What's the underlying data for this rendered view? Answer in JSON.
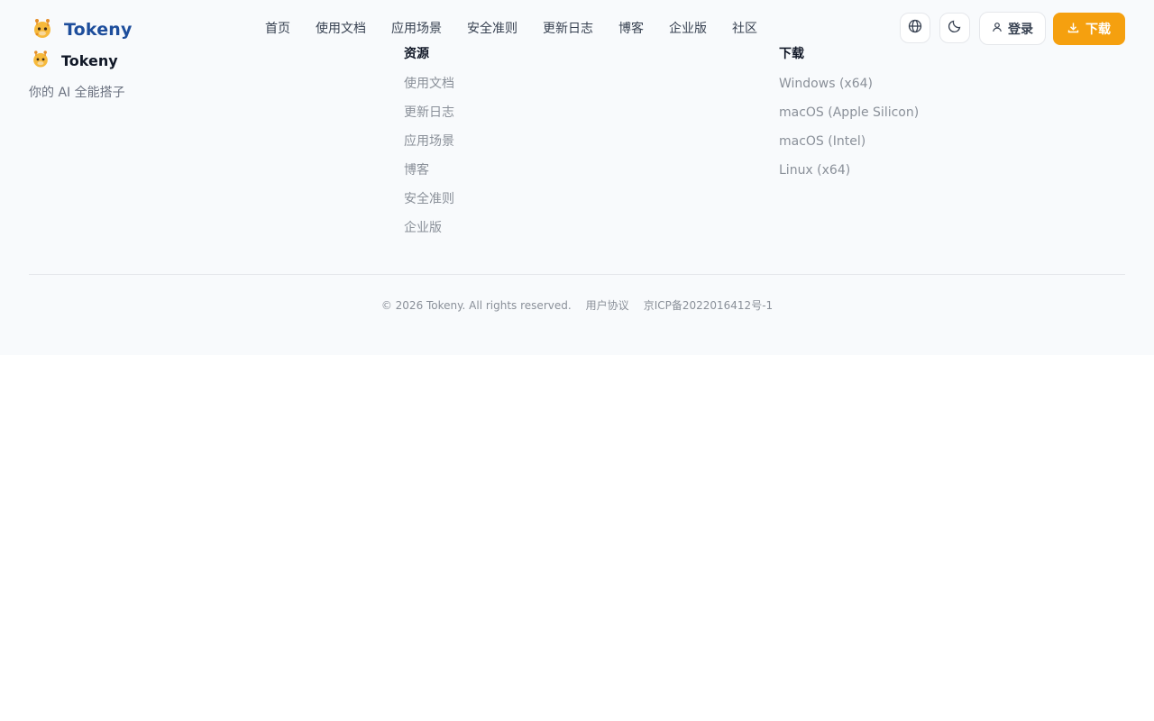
{
  "header": {
    "brand_name": "Tokeny",
    "nav": [
      "首页",
      "使用文档",
      "应用场景",
      "安全准则",
      "更新日志",
      "博客",
      "企业版",
      "社区"
    ],
    "icons": [
      "globe-icon",
      "moon-icon"
    ],
    "login_label": "登录",
    "download_label": "下载"
  },
  "footer": {
    "brand_name": "Tokeny",
    "tagline": "你的 AI 全能搭子",
    "resources": {
      "title": "资源",
      "links": [
        "使用文档",
        "更新日志",
        "应用场景",
        "博客",
        "安全准则",
        "企业版"
      ]
    },
    "downloads": {
      "title": "下载",
      "links": [
        "Windows (x64)",
        "macOS (Apple Silicon)",
        "macOS (Intel)",
        "Linux (x64)"
      ]
    },
    "copyright": "© 2026 Tokeny. All rights reserved.",
    "user_agreement": "用户协议",
    "icp": "京ICP备2022016412号-1"
  },
  "colors": {
    "brand_blue": "#1e4e9c",
    "accent_orange": "#f5a00f",
    "footer_bg": "#f8fafc"
  }
}
